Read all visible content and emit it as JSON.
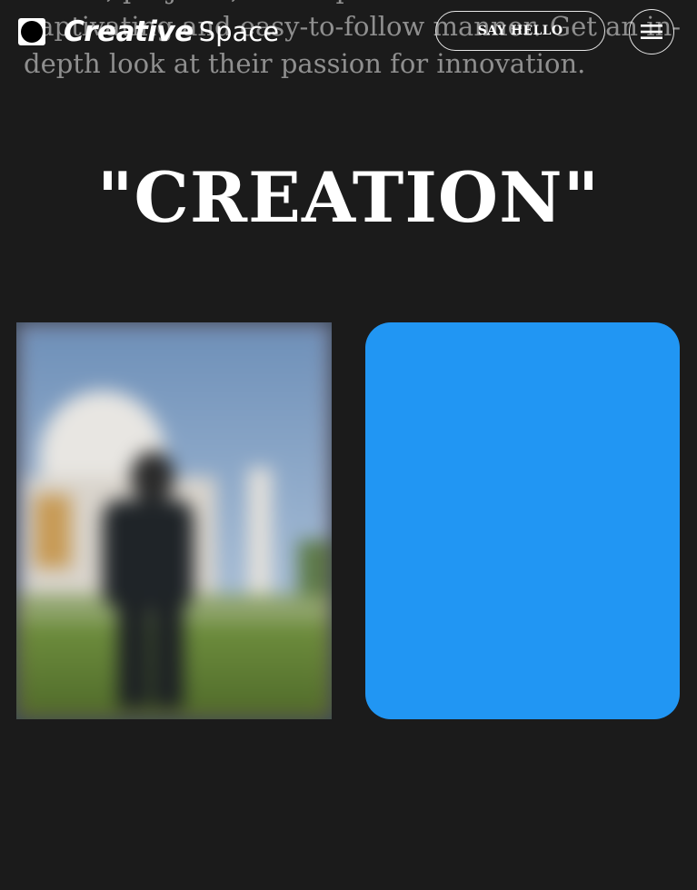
{
  "intro": {
    "lines": [
      "studio, projects, and expertise in a",
      "captivating and easy-to-follow manner. Get an in-",
      "depth look at their passion for innovation."
    ]
  },
  "header": {
    "logo_word_a": "Creative",
    "logo_word_b": "Space",
    "say_hello_label": "SAY HELLO"
  },
  "section": {
    "title": "\"CREATION\""
  },
  "colors": {
    "background": "#1b1b1b",
    "accent_blue": "#2196f3",
    "muted_text": "#8f8f8f"
  }
}
